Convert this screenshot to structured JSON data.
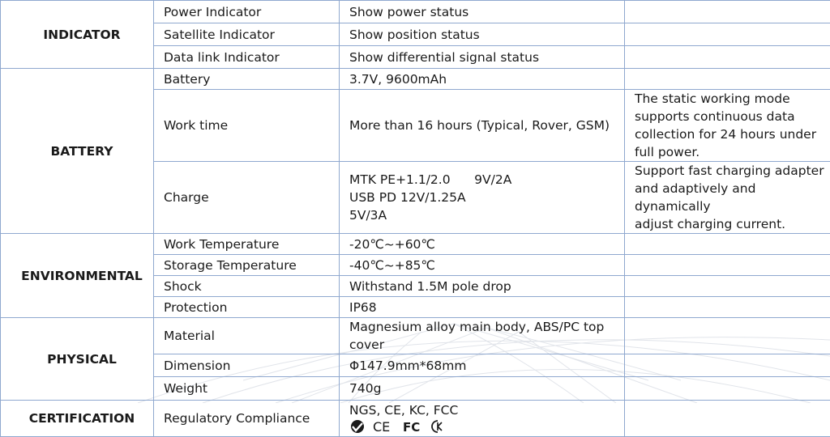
{
  "sections": [
    {
      "category": "INDICATOR",
      "rows": [
        {
          "item": "Power Indicator",
          "value": "Show power status",
          "note": ""
        },
        {
          "item": "Satellite Indicator",
          "value": "Show position status",
          "note": ""
        },
        {
          "item": "Data link Indicator",
          "value": "Show differential signal status",
          "note": ""
        }
      ]
    },
    {
      "category": "BATTERY",
      "rows": [
        {
          "item": "Battery",
          "value": "3.7V, 9600mAh",
          "note": ""
        },
        {
          "item": "Work time",
          "value": "More than 16 hours (Typical, Rover, GSM)",
          "note_lines": [
            "The static working mode",
            "supports continuous data",
            "collection for 24 hours under",
            "full power."
          ]
        },
        {
          "item": "Charge",
          "value_lines": [
            "MTK PE+1.1/2.0      9V/2A",
            "USB PD 12V/1.25A",
            "5V/3A"
          ],
          "note_lines": [
            "Support fast charging adapter",
            "and adaptively and dynamically",
            "adjust charging current."
          ]
        }
      ]
    },
    {
      "category": "ENVIRONMENTAL",
      "rows": [
        {
          "item": "Work Temperature",
          "value": "-20℃~+60℃",
          "note": ""
        },
        {
          "item": "Storage Temperature",
          "value": "-40℃~+85℃",
          "note": ""
        },
        {
          "item": "Shock",
          "value": "Withstand 1.5M pole drop",
          "note": ""
        },
        {
          "item": "Protection",
          "value": "IP68",
          "note": ""
        }
      ]
    },
    {
      "category": "PHYSICAL",
      "rows": [
        {
          "item": "Material",
          "value": "Magnesium alloy main body, ABS/PC top cover",
          "note": ""
        },
        {
          "item": "Dimension",
          "value": "Φ147.9mm*68mm",
          "note": ""
        },
        {
          "item": "Weight",
          "value": "740g",
          "note": ""
        }
      ]
    },
    {
      "category": "CERTIFICATION",
      "rows": [
        {
          "item": "Regulatory Compliance",
          "value": "NGS, CE, KC, FCC",
          "note": "",
          "cert_marks": [
            "CE",
            "FC"
          ]
        }
      ]
    }
  ],
  "colors": {
    "border": "#8fa8cf",
    "text": "#1a1a1a"
  },
  "icons": [
    "ngs-logo-icon",
    "ce-mark-icon",
    "fcc-mark-icon",
    "kc-mark-icon"
  ]
}
